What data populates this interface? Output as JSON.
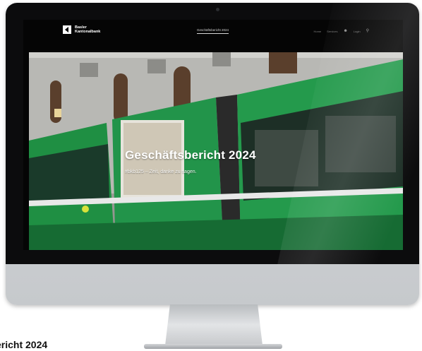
{
  "site": {
    "logo": {
      "line1": "Basler",
      "line2": "Kantonalbank"
    },
    "nav_center": "Geschäftsbericht 2024",
    "nav_right": {
      "home": "Home",
      "services": "Services",
      "login": "Login"
    }
  },
  "hero": {
    "headline": "Geschäftsbericht 2024",
    "subline": "#bkb125 – Zeit, danke zu sagen."
  },
  "caption": "ericht 2024",
  "colors": {
    "tram_green": "#1f8f43",
    "screen_black": "#050505"
  },
  "icons": [
    "user-icon",
    "search-icon",
    "apple-logo-icon"
  ]
}
